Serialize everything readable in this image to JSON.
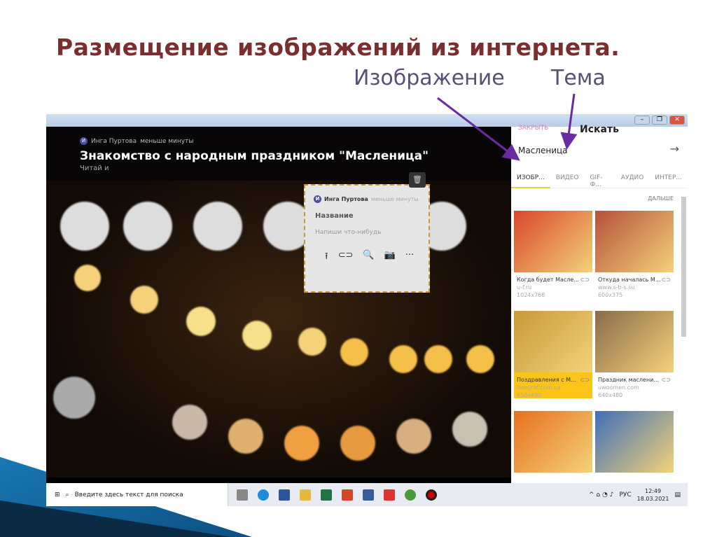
{
  "slide": {
    "title": "Размещение изображений из интернета.",
    "label_image": "Изображение",
    "label_topic": "Тема"
  },
  "window": {
    "min": "–",
    "restore": "❐",
    "close": "✕"
  },
  "post": {
    "author_initial": "И",
    "author": "Инга Пуртова",
    "time": "меньше минуты",
    "title": "Знакомство с народным праздником \"Масленица\"",
    "subtitle": "Читай и"
  },
  "card": {
    "author_initial": "И",
    "author": "Инга Пуртова",
    "time": "меньше минуты",
    "name_placeholder": "Название",
    "text_placeholder": "Напиши что-нибудь",
    "icons": [
      "upload-icon",
      "link-icon",
      "search-image-icon",
      "camera-icon",
      "more-icon"
    ],
    "trash": "🗑"
  },
  "panel": {
    "close": "ЗАКРЫТЬ",
    "search_title": "Искать",
    "query": "Масленица",
    "go": "→",
    "tabs": [
      "ИЗОБР...",
      "ВИДЕО",
      "GIF-Ф...",
      "АУДИО",
      "ИНТЕР..."
    ],
    "more": "ДАЛЬШЕ",
    "results": [
      {
        "title": "Когда будет Масле...",
        "site": "u-f.ru",
        "size": "1024x768",
        "color": "#d9472b"
      },
      {
        "title": "Откуда началась М...",
        "site": "www.s-b-s.su",
        "size": "600x375",
        "color": "#b5513a"
      },
      {
        "title": "Поздравления с М...",
        "site": "telegraf.com.ua",
        "size": "650x490",
        "color": "#c79a3a"
      },
      {
        "title": "Праздник маслени...",
        "site": "uwoomen.com",
        "size": "640x480",
        "color": "#8a6b4a"
      },
      {
        "title": "",
        "site": "",
        "size": "",
        "color": "#e8701f"
      },
      {
        "title": "",
        "site": "",
        "size": "",
        "color": "#3f6fb8"
      }
    ]
  },
  "taskbar": {
    "search_placeholder": "Введите здесь текст для поиска",
    "lang": "РУС",
    "time": "12:49",
    "date": "18.03.2021",
    "tray": "^ ⌂ ◔ ♪"
  }
}
